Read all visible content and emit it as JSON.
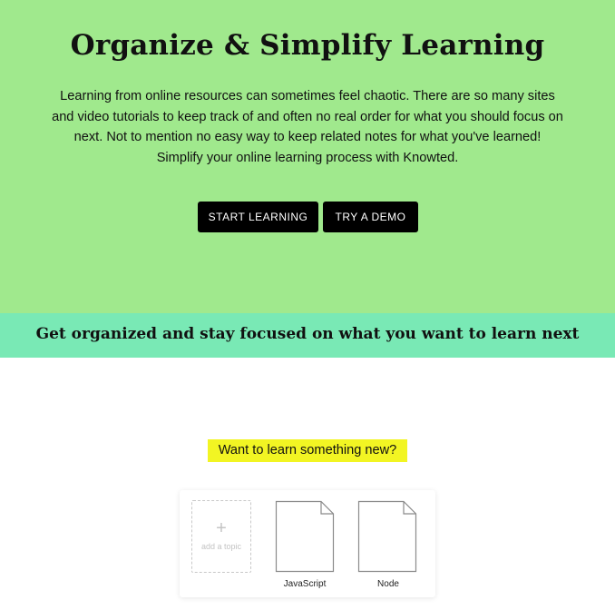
{
  "hero": {
    "title": "Organize & Simplify Learning",
    "description": "Learning from online resources can sometimes feel chaotic. There are so many sites and video tutorials to keep track of and often no real order for what you should focus on next. Not to mention no easy way to keep related notes for what you've learned! Simplify your online learning process with Knowted.",
    "start_button": "START LEARNING",
    "demo_button": "TRY A DEMO"
  },
  "banner": {
    "text": "Get organized and stay focused on what you want to learn next"
  },
  "topics": {
    "prompt": "Want to learn something new?",
    "add_plus": "+",
    "add_label": "add a topic",
    "items": [
      {
        "label": "JavaScript",
        "icon": "document-icon"
      },
      {
        "label": "Node",
        "icon": "document-icon"
      }
    ]
  },
  "colors": {
    "hero_bg": "#a0e98d",
    "banner_bg": "#79e9b5",
    "highlight": "#f2f523",
    "button_bg": "#000000"
  }
}
